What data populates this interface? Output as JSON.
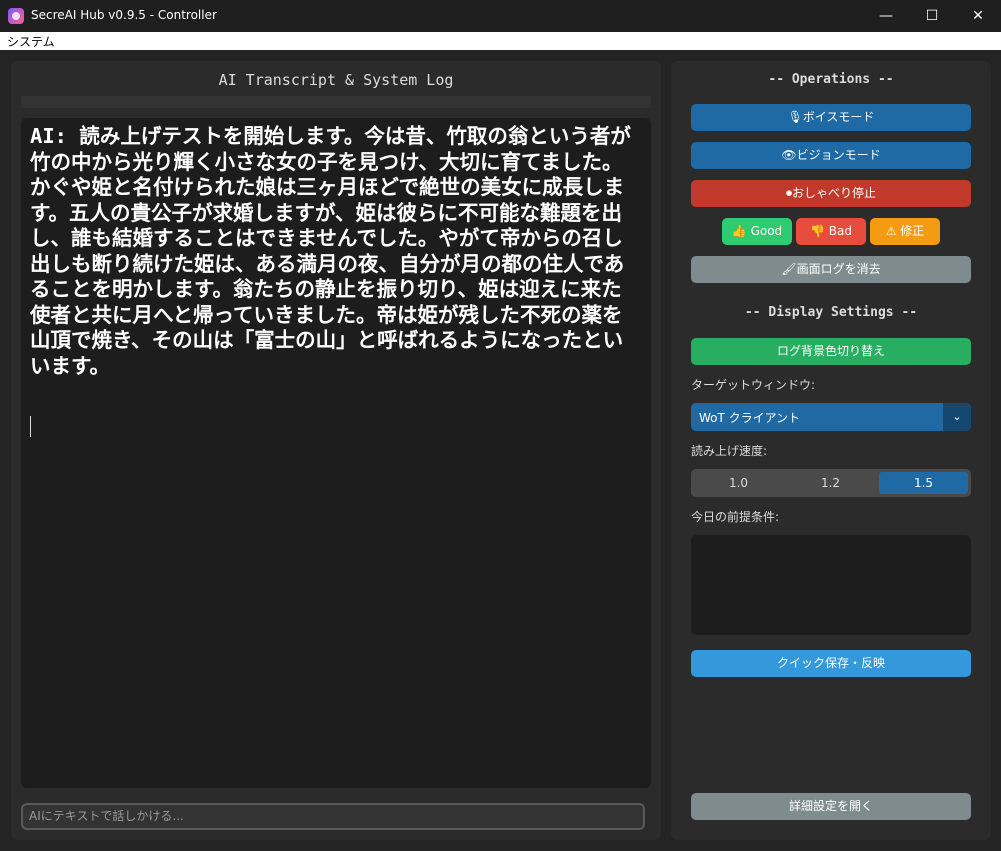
{
  "window": {
    "title": "SecreAI Hub v0.9.5 - Controller"
  },
  "menu": {
    "items": [
      "システム"
    ]
  },
  "log_panel": {
    "title": "AI Transcript & System Log",
    "text": "AI: 読み上げテストを開始します。今は昔、竹取の翁という者が竹の中から光り輝く小さな女の子を見つけ、大切に育てました。かぐや姫と名付けられた娘は三ヶ月ほどで絶世の美女に成長します。五人の貴公子が求婚しますが、姫は彼らに不可能な難題を出し、誰も結婚することはできませんでした。やがて帝からの召し出しも断り続けた姫は、ある満月の夜、自分が月の都の住人であることを明かします。翁たちの静止を振り切り、姫は迎えに来た使者と共に月へと帰っていきました。帝は姫が残した不死の薬を山頂で焼き、その山は「富士の山」と呼ばれるようになったといいます。",
    "input_placeholder": "AIにテキストで話しかける..."
  },
  "operations": {
    "title": "-- Operations --",
    "voice_mode": "🎙ボイスモード",
    "vision_mode": "👁ビジョンモード",
    "stop_talking": "⏺おしゃべり停止",
    "good": "👍 Good",
    "bad": "👎 Bad",
    "fix": "⚠ 修正",
    "clear_log": "🖌画面ログを消去"
  },
  "display_settings": {
    "title": "-- Display Settings --",
    "toggle_bg": "ログ背景色切り替え",
    "target_window_label": "ターゲットウィンドウ:",
    "target_window_value": "WoT クライアント",
    "speed_label": "読み上げ速度:",
    "speeds": [
      "1.0",
      "1.2",
      "1.5"
    ],
    "selected_speed": "1.5",
    "premise_label": "今日の前提条件:",
    "premise_value": "",
    "quick_save": "クイック保存・反映",
    "open_settings": "詳細設定を開く"
  },
  "colors": {
    "primary": "#1f6aa5",
    "danger": "#c0392b",
    "success": "#27ae60",
    "warning": "#f39c12",
    "neutral": "#7f8c8d"
  }
}
